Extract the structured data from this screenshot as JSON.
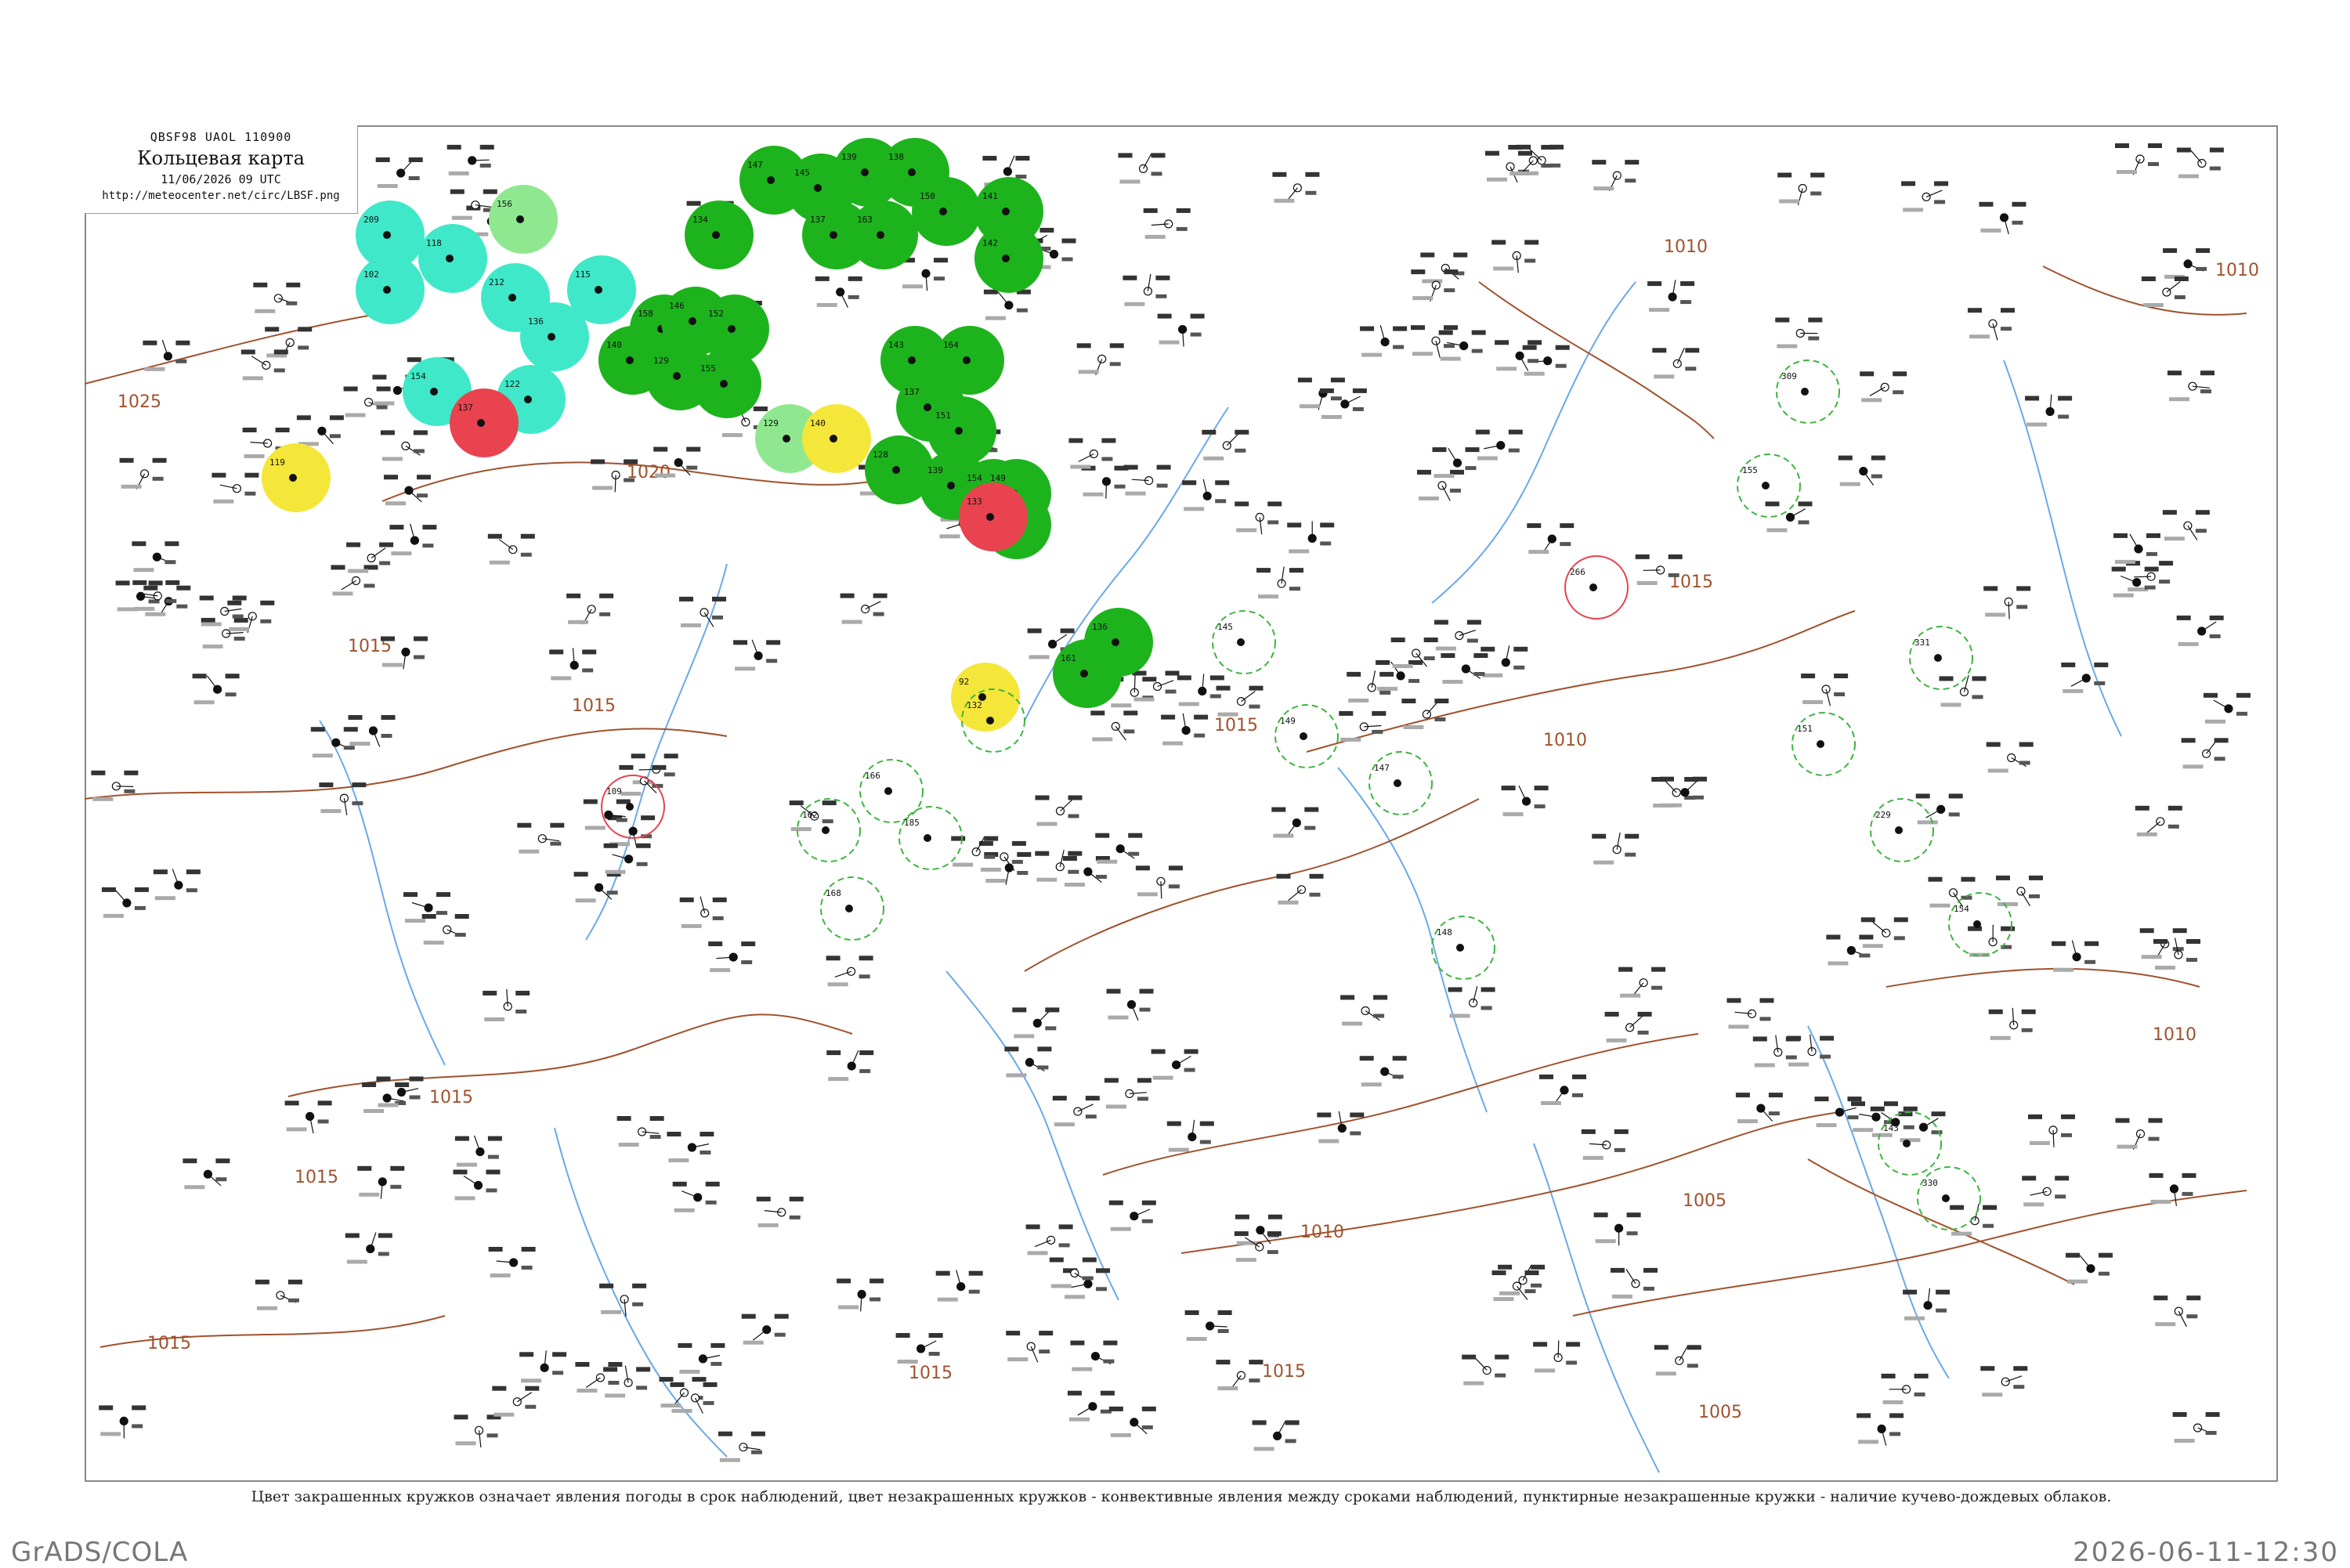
{
  "header": {
    "codes": "QBSF98  UAOL  110900",
    "title": "Кольцевая карта",
    "date": "11/06/2026 09 UTC",
    "url": "http://meteocenter.net/circ/LBSF.png"
  },
  "caption": "Цвет закрашенных кружков означает явления погоды в срок наблюдений, цвет незакрашенных кружков - конвективные явления между сроками наблюдений, пунктирные незакрашенные кружки - наличие кучево-дождевых облаков.",
  "footer": {
    "left": "GrADS/COLA",
    "right": "2026-06-11-12:30"
  },
  "colors": {
    "rain": "#1db31d",
    "showers": "#3fe8c8",
    "fog": "#f5e63a",
    "thunder": "#e8434f",
    "light": "#8fe88f",
    "isobar": "#a0522d",
    "river": "#6aa8e8",
    "cb_dashed": "#3fb43f"
  },
  "isobars": [
    {
      "label": "1025"
    },
    {
      "label": "1020"
    },
    {
      "label": "1015"
    },
    {
      "label": "1015"
    },
    {
      "label": "1015"
    },
    {
      "label": "1015"
    },
    {
      "label": "1015"
    },
    {
      "label": "1015"
    },
    {
      "label": "1015"
    },
    {
      "label": "1010"
    },
    {
      "label": "1010"
    },
    {
      "label": "1010"
    },
    {
      "label": "1010"
    },
    {
      "label": "1010"
    },
    {
      "label": "1005"
    },
    {
      "label": "1005"
    },
    {
      "label": "1015"
    },
    {
      "label": "1015"
    }
  ],
  "stations": [
    {
      "t": "rain",
      "v": "147"
    },
    {
      "t": "rain",
      "v": "145"
    },
    {
      "t": "rain",
      "v": "139"
    },
    {
      "t": "rain",
      "v": "138"
    },
    {
      "t": "rain",
      "v": "150"
    },
    {
      "t": "rain",
      "v": "141"
    },
    {
      "t": "rain",
      "v": "142"
    },
    {
      "t": "rain",
      "v": "137"
    },
    {
      "t": "rain",
      "v": "163"
    },
    {
      "t": "rain",
      "v": "134"
    },
    {
      "t": "rain",
      "v": "158"
    },
    {
      "t": "rain",
      "v": "146"
    },
    {
      "t": "rain",
      "v": "152"
    },
    {
      "t": "rain",
      "v": "140"
    },
    {
      "t": "rain",
      "v": "129"
    },
    {
      "t": "rain",
      "v": "155"
    },
    {
      "t": "rain",
      "v": "143"
    },
    {
      "t": "rain",
      "v": "137"
    },
    {
      "t": "rain",
      "v": "164"
    },
    {
      "t": "rain",
      "v": "151"
    },
    {
      "t": "rain",
      "v": "128"
    },
    {
      "t": "rain",
      "v": "139"
    },
    {
      "t": "rain",
      "v": "154"
    },
    {
      "t": "rain",
      "v": "144"
    },
    {
      "t": "rain",
      "v": "136"
    },
    {
      "t": "rain",
      "v": "161"
    },
    {
      "t": "rain",
      "v": "149"
    },
    {
      "t": "showers",
      "v": "209"
    },
    {
      "t": "showers",
      "v": "102"
    },
    {
      "t": "showers",
      "v": "118"
    },
    {
      "t": "showers",
      "v": "212"
    },
    {
      "t": "showers",
      "v": "136"
    },
    {
      "t": "showers",
      "v": "115"
    },
    {
      "t": "showers",
      "v": "122"
    },
    {
      "t": "showers",
      "v": "154"
    },
    {
      "t": "light",
      "v": "156"
    },
    {
      "t": "light",
      "v": "129"
    },
    {
      "t": "fog",
      "v": "140"
    },
    {
      "t": "fog",
      "v": "119"
    },
    {
      "t": "fog",
      "v": "92"
    },
    {
      "t": "thunder",
      "v": "137"
    },
    {
      "t": "thunder",
      "v": "133"
    },
    {
      "t": "cb",
      "v": "145"
    },
    {
      "t": "cb",
      "v": "132"
    },
    {
      "t": "cb",
      "v": "166"
    },
    {
      "t": "cb",
      "v": "185"
    },
    {
      "t": "cb",
      "v": "162"
    },
    {
      "t": "cb",
      "v": "168"
    },
    {
      "t": "cb",
      "v": "149"
    },
    {
      "t": "cb",
      "v": "147"
    },
    {
      "t": "cb",
      "v": "148"
    },
    {
      "t": "cb",
      "v": "309"
    },
    {
      "t": "cb",
      "v": "155"
    },
    {
      "t": "cb",
      "v": "151"
    },
    {
      "t": "cb",
      "v": "331"
    },
    {
      "t": "cb",
      "v": "229"
    },
    {
      "t": "cb",
      "v": "154"
    },
    {
      "t": "cb",
      "v": "143"
    },
    {
      "t": "cb",
      "v": "330"
    },
    {
      "t": "ring",
      "v": "266"
    },
    {
      "t": "ring",
      "v": "109"
    }
  ]
}
